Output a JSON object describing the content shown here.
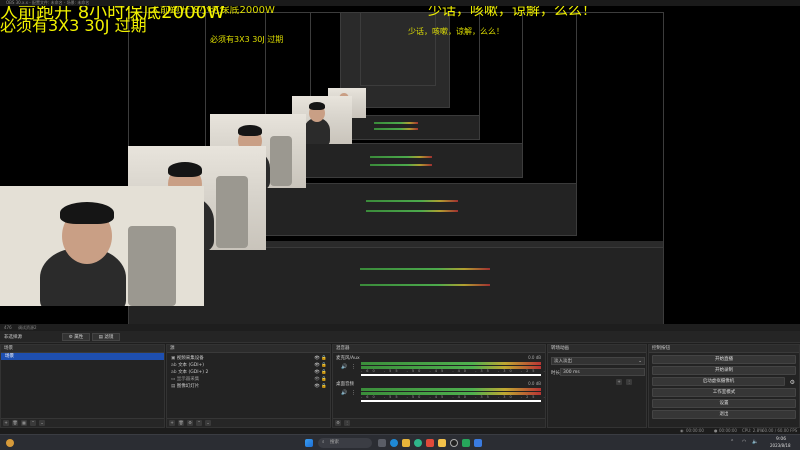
{
  "window": {
    "title": "OBS 30.x.x - 配置文件: 未命名 - 场景: 未命名"
  },
  "overlay": {
    "line1": "人前跑开 8小时保底2000W",
    "line2": "必须有3X3 30J 过期",
    "right1": "少话，咳嗽，谅解，么么！"
  },
  "status_row": {
    "left": "476",
    "mid": "调试资源2"
  },
  "tabs_row": {
    "scene_tab": "非选择源",
    "props": "属性",
    "filters": "滤镜"
  },
  "scenes": {
    "title": "场景",
    "items": [
      {
        "label": "场景"
      }
    ]
  },
  "sources": {
    "title": "源",
    "items": [
      {
        "label": "视频采集设备"
      },
      {
        "label": "文本 (GDI+)"
      },
      {
        "label": "文本 (GDI+) 2"
      },
      {
        "label": "显示器采集"
      },
      {
        "label": "图像幻灯片"
      }
    ]
  },
  "mixer": {
    "title": "混音器",
    "tracks": [
      {
        "name": "麦克风/Aux",
        "db": "0.0 dB"
      },
      {
        "name": "桌面音频",
        "db": "0.0 dB"
      }
    ],
    "scale": "-60 -55 -50 -45 -40 -35 -30 -25 -20 -15 -10 -5 0"
  },
  "transitions": {
    "title": "转场动画",
    "type": "淡入淡出",
    "duration_label": "时长",
    "duration_value": "300 ms"
  },
  "controls": {
    "title": "控制按钮",
    "buttons": [
      {
        "label": "开始直播"
      },
      {
        "label": "开始录制"
      },
      {
        "label": "启动虚拟摄像机"
      },
      {
        "label": "工作室模式"
      },
      {
        "label": "设置"
      },
      {
        "label": "退出"
      }
    ]
  },
  "statusbar": {
    "time_live": "00:00:00",
    "time_rec": "00:00:00",
    "cpu": "CPU: 2.8%",
    "fps": "60.00 / 60.00 FPS"
  },
  "taskbar": {
    "search_placeholder": "搜索",
    "time": "9:06",
    "date": "2023/8/18"
  }
}
